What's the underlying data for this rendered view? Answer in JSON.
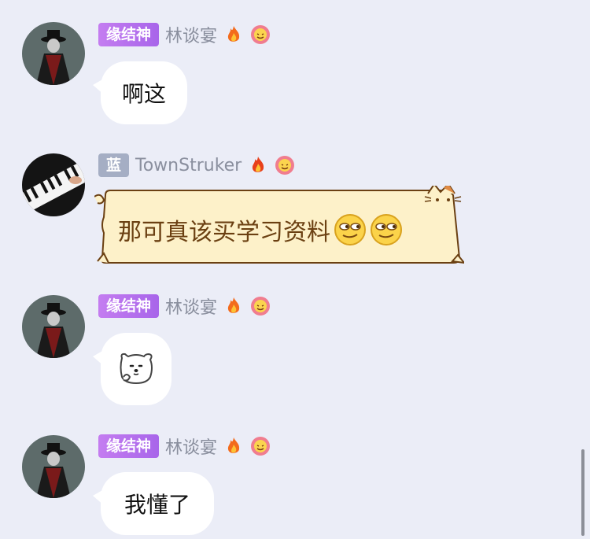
{
  "messages": [
    {
      "badge": "缘结神",
      "nickname": "林谈宴",
      "text": "啊这"
    },
    {
      "badge": "蓝",
      "nickname": "TownStruker",
      "text": "那可真该买学习资料"
    },
    {
      "badge": "缘结神",
      "nickname": "林谈宴",
      "text": ""
    },
    {
      "badge": "缘结神",
      "nickname": "林谈宴",
      "text": "我懂了"
    }
  ],
  "icons": {
    "fire": "fire-icon",
    "flower": "flower-icon",
    "smiley": "smirk-emoji",
    "bear": "bear-sticker"
  },
  "colors": {
    "background": "#ebedf7",
    "badge_purple": "#b572ed",
    "badge_grey": "#a5aec4",
    "nickname": "#8a8f9e",
    "cat_bubble_fill": "#fdf1c9",
    "cat_bubble_text": "#6b4012"
  }
}
